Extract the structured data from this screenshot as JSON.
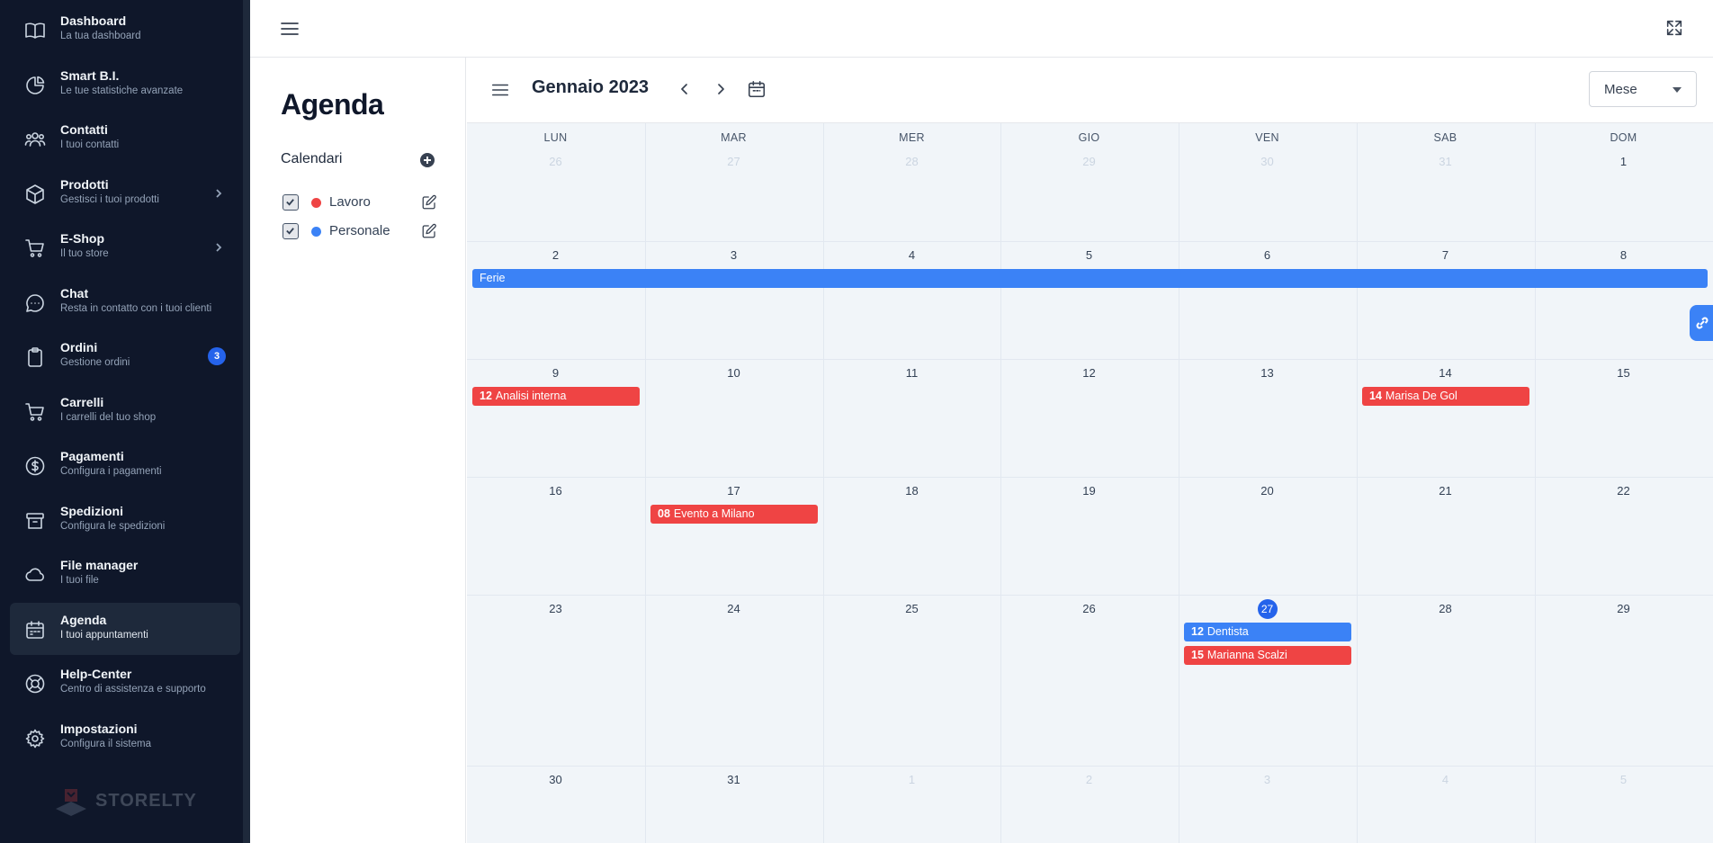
{
  "sidebar": {
    "items": [
      {
        "title": "Dashboard",
        "sub": "La tua dashboard",
        "icon": "book-icon"
      },
      {
        "title": "Smart B.I.",
        "sub": "Le tue statistiche avanzate",
        "icon": "pie-chart-icon"
      },
      {
        "title": "Contatti",
        "sub": "I tuoi contatti",
        "icon": "users-icon"
      },
      {
        "title": "Prodotti",
        "sub": "Gestisci i tuoi prodotti",
        "icon": "box-icon",
        "chevron": true
      },
      {
        "title": "E-Shop",
        "sub": "Il tuo store",
        "icon": "cart-icon",
        "chevron": true
      },
      {
        "title": "Chat",
        "sub": "Resta in contatto con i tuoi clienti",
        "icon": "chat-icon"
      },
      {
        "title": "Ordini",
        "sub": "Gestione ordini",
        "icon": "clipboard-icon",
        "badge": "3"
      },
      {
        "title": "Carrelli",
        "sub": "I carrelli del tuo shop",
        "icon": "cart-icon"
      },
      {
        "title": "Pagamenti",
        "sub": "Configura i pagamenti",
        "icon": "dollar-icon"
      },
      {
        "title": "Spedizioni",
        "sub": "Configura le spedizioni",
        "icon": "archive-icon"
      },
      {
        "title": "File manager",
        "sub": "I tuoi file",
        "icon": "cloud-icon"
      },
      {
        "title": "Agenda",
        "sub": "I tuoi appuntamenti",
        "icon": "calendar-icon",
        "active": true
      },
      {
        "title": "Help-Center",
        "sub": "Centro di assistenza e supporto",
        "icon": "lifebuoy-icon"
      },
      {
        "title": "Impostazioni",
        "sub": "Configura il sistema",
        "icon": "gear-icon"
      }
    ],
    "logo_text": "STORELTY"
  },
  "page": {
    "title": "Agenda",
    "calendars_heading": "Calendari",
    "calendars": [
      {
        "label": "Lavoro",
        "color": "#ef4444",
        "checked": true
      },
      {
        "label": "Personale",
        "color": "#3b82f6",
        "checked": true
      }
    ]
  },
  "calendar": {
    "month_title": "Gennaio 2023",
    "view": "Mese",
    "weekdays": [
      "LUN",
      "MAR",
      "MER",
      "GIO",
      "VEN",
      "SAB",
      "DOM"
    ],
    "weeks": [
      [
        {
          "d": "26",
          "muted": true
        },
        {
          "d": "27",
          "muted": true
        },
        {
          "d": "28",
          "muted": true
        },
        {
          "d": "29",
          "muted": true
        },
        {
          "d": "30",
          "muted": true
        },
        {
          "d": "31",
          "muted": true
        },
        {
          "d": "1"
        }
      ],
      [
        {
          "d": "2"
        },
        {
          "d": "3"
        },
        {
          "d": "4"
        },
        {
          "d": "5"
        },
        {
          "d": "6"
        },
        {
          "d": "7"
        },
        {
          "d": "8"
        }
      ],
      [
        {
          "d": "9"
        },
        {
          "d": "10"
        },
        {
          "d": "11"
        },
        {
          "d": "12"
        },
        {
          "d": "13"
        },
        {
          "d": "14"
        },
        {
          "d": "15"
        }
      ],
      [
        {
          "d": "16"
        },
        {
          "d": "17"
        },
        {
          "d": "18"
        },
        {
          "d": "19"
        },
        {
          "d": "20"
        },
        {
          "d": "21"
        },
        {
          "d": "22"
        }
      ],
      [
        {
          "d": "23"
        },
        {
          "d": "24"
        },
        {
          "d": "25"
        },
        {
          "d": "26"
        },
        {
          "d": "27",
          "today": true
        },
        {
          "d": "28"
        },
        {
          "d": "29"
        }
      ],
      [
        {
          "d": "30"
        },
        {
          "d": "31"
        },
        {
          "d": "1",
          "muted": true
        },
        {
          "d": "2",
          "muted": true
        },
        {
          "d": "3",
          "muted": true
        },
        {
          "d": "4",
          "muted": true
        },
        {
          "d": "5",
          "muted": true
        }
      ]
    ],
    "events": [
      {
        "week": 1,
        "day": 0,
        "span": 7,
        "slot": 0,
        "time": "",
        "title": "Ferie",
        "color": "blue"
      },
      {
        "week": 2,
        "day": 0,
        "span": 1,
        "slot": 0,
        "time": "12",
        "title": "Analisi interna",
        "color": "red"
      },
      {
        "week": 2,
        "day": 5,
        "span": 1,
        "slot": 0,
        "time": "14",
        "title": "Marisa De Gol",
        "color": "red"
      },
      {
        "week": 3,
        "day": 1,
        "span": 1,
        "slot": 0,
        "time": "08",
        "title": "Evento a Milano",
        "color": "red"
      },
      {
        "week": 4,
        "day": 4,
        "span": 1,
        "slot": 0,
        "time": "12",
        "title": "Dentista",
        "color": "blue"
      },
      {
        "week": 4,
        "day": 4,
        "span": 1,
        "slot": 1,
        "time": "15",
        "title": "Marianna Scalzi",
        "color": "red"
      }
    ]
  }
}
